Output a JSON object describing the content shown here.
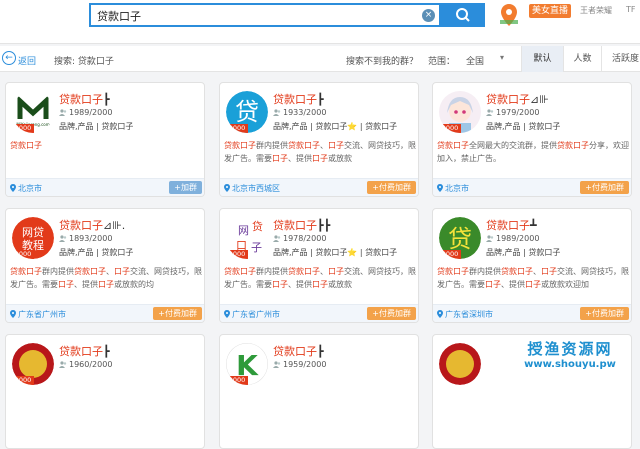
{
  "search": {
    "value": "贷款口子",
    "clear_icon": "×"
  },
  "header": {
    "live_tag": "美女直播",
    "user": "王者荣耀",
    "extra": "TF"
  },
  "filter": {
    "back_label": "返回",
    "search_label": "搜索: 贷款口子",
    "not_found": "搜索不到我的群？",
    "range_label": "范围：",
    "range_value": "全国",
    "tabs": [
      "默认",
      "人数",
      "活跃度"
    ]
  },
  "colors": {
    "accent": "#2b8ddb",
    "keyword": "#e23a1a",
    "paid_button": "#f3a24a",
    "free_button": "#7fb0dc"
  },
  "cards": [
    {
      "name": "贷款口子",
      "suffix": "┣",
      "stat": "1989/2000",
      "badge": "2000",
      "tags": "品牌,产品 | 贷款口子",
      "desc_html": "<span class='kw'>贷款口子</span>",
      "location": "北京市",
      "join": "+加群",
      "join_type": "free",
      "avatar": "mk",
      "avatar_text": "MiKajinrong.com"
    },
    {
      "name": "贷款口子",
      "suffix": "┣",
      "stat": "1933/2000",
      "badge": "2000",
      "tags": "品牌,产品 | 贷款口子⭐ | 贷款口子",
      "desc_html": "<span class='kw'>贷款口子</span>群内提供<span class='kw'>贷款口子</span>、<span class='kw'>口子</span>交流、网贷技巧，限发广告。需要<span class='kw'>口子</span>、提供<span class='kw'>口子</span>或放款",
      "location": "北京市西城区",
      "join": "+付费加群",
      "join_type": "paid",
      "avatar": "dai",
      "avatar_text": "贷"
    },
    {
      "name": "贷款口子",
      "suffix": "⊿⊪",
      "stat": "1979/2000",
      "badge": "2000",
      "tags": "品牌,产品 | 贷款口子",
      "desc_html": "<span class='kw'>贷款口子</span>全网最大的交流群，提供<span class='kw'>贷款口子</span>分享，欢迎加入，禁止广告。",
      "location": "北京市",
      "join": "+付费加群",
      "join_type": "paid",
      "avatar": "anime",
      "avatar_text": ""
    },
    {
      "name": "贷款口子",
      "suffix": "⊿⊪.",
      "stat": "1893/2000",
      "badge": "2000",
      "tags": "品牌,产品 | 贷款口子",
      "desc_html": "<span class='kw'>贷款口子</span>群内提供<span class='kw'>贷款口子</span>、<span class='kw'>口子</span>交流、网贷技巧，限发广告。需要<span class='kw'>口子</span>、提供<span class='kw'>口子</span>或放款的均",
      "location": "广东省广州市",
      "join": "+付费加群",
      "join_type": "paid",
      "avatar": "wd",
      "avatar_text": "网贷教程"
    },
    {
      "name": "贷款口子",
      "suffix": "┣┣",
      "stat": "1978/2000",
      "badge": "2000",
      "tags": "品牌,产品 | 贷款口子⭐ | 贷款口子",
      "desc_html": "<span class='kw'>贷款口子</span>群内提供<span class='kw'>贷款口子</span>、<span class='kw'>口子</span>交流、网贷技巧，限发广告。需要<span class='kw'>口子</span>、提供<span class='kw'>口子</span>或放款",
      "location": "广东省广州市",
      "join": "+付费加群",
      "join_type": "paid",
      "avatar": "wdkz",
      "avatar_text": "网贷口子"
    },
    {
      "name": "贷款口子",
      "suffix": "┻",
      "stat": "1989/2000",
      "badge": "2000",
      "tags": "品牌,产品 | 贷款口子",
      "desc_html": "<span class='kw'>贷款口子</span>群内提供<span class='kw'>贷款口子</span>、<span class='kw'>口子</span>交流、网贷技巧，限发广告。需要<span class='kw'>口子</span>、提供<span class='kw'>口子</span>或放款欢迎加",
      "location": "广东省深圳市",
      "join": "+付费加群",
      "join_type": "paid",
      "avatar": "green",
      "avatar_text": "贷"
    },
    {
      "name": "贷款口子",
      "suffix": "┣",
      "stat": "1960/2000",
      "badge": "2000",
      "tags": "",
      "desc_html": "",
      "location": "",
      "join": "",
      "join_type": "free",
      "avatar": "gold",
      "avatar_text": ""
    },
    {
      "name": "贷款口子",
      "suffix": "┣",
      "stat": "1959/2000",
      "badge": "2000",
      "tags": "",
      "desc_html": "",
      "location": "",
      "join": "",
      "join_type": "free",
      "avatar": "k",
      "avatar_text": "K"
    },
    {
      "name": "",
      "suffix": "",
      "stat": "",
      "badge": "",
      "tags": "",
      "desc_html": "",
      "location": "",
      "join": "",
      "join_type": "free",
      "avatar": "gold",
      "avatar_text": ""
    }
  ],
  "watermark": {
    "cn": "授渔资源网",
    "en": "www.shouyu.pw"
  }
}
